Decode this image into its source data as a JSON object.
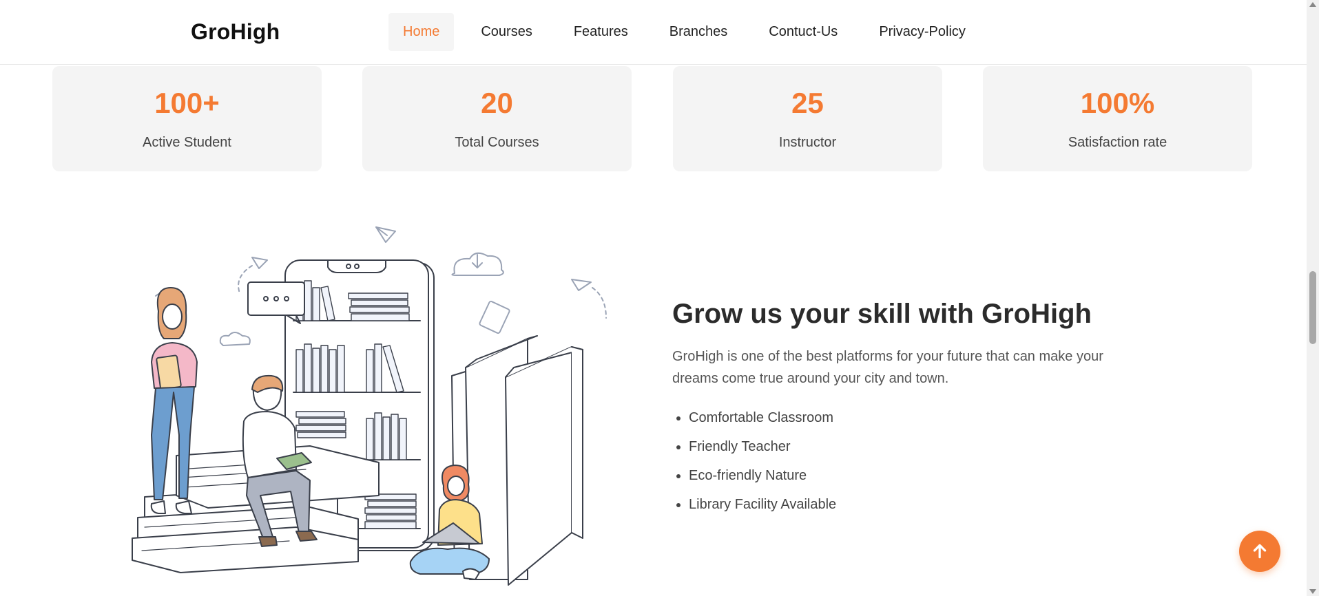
{
  "header": {
    "logo": "GroHigh",
    "nav": [
      {
        "label": "Home",
        "active": true
      },
      {
        "label": "Courses",
        "active": false
      },
      {
        "label": "Features",
        "active": false
      },
      {
        "label": "Branches",
        "active": false
      },
      {
        "label": "Contuct-Us",
        "active": false
      },
      {
        "label": "Privacy-Policy",
        "active": false
      }
    ]
  },
  "stats": [
    {
      "value": "100+",
      "label": "Active Student"
    },
    {
      "value": "20",
      "label": "Total Courses"
    },
    {
      "value": "25",
      "label": "Instructor"
    },
    {
      "value": "100%",
      "label": "Satisfaction rate"
    }
  ],
  "about": {
    "heading": "Grow us your skill with GroHigh",
    "description": "GroHigh is one of the best platforms for your future that can make your dreams come true around your city and town.",
    "features": [
      "Comfortable Classroom",
      "Friendly Teacher",
      "Eco-friendly Nature",
      "Library Facility Available"
    ]
  },
  "colors": {
    "accent": "#f47a32",
    "card_bg": "#f4f4f4",
    "heading": "#2b2b2b"
  },
  "icons": {
    "scroll_top": "arrow-up-icon"
  }
}
